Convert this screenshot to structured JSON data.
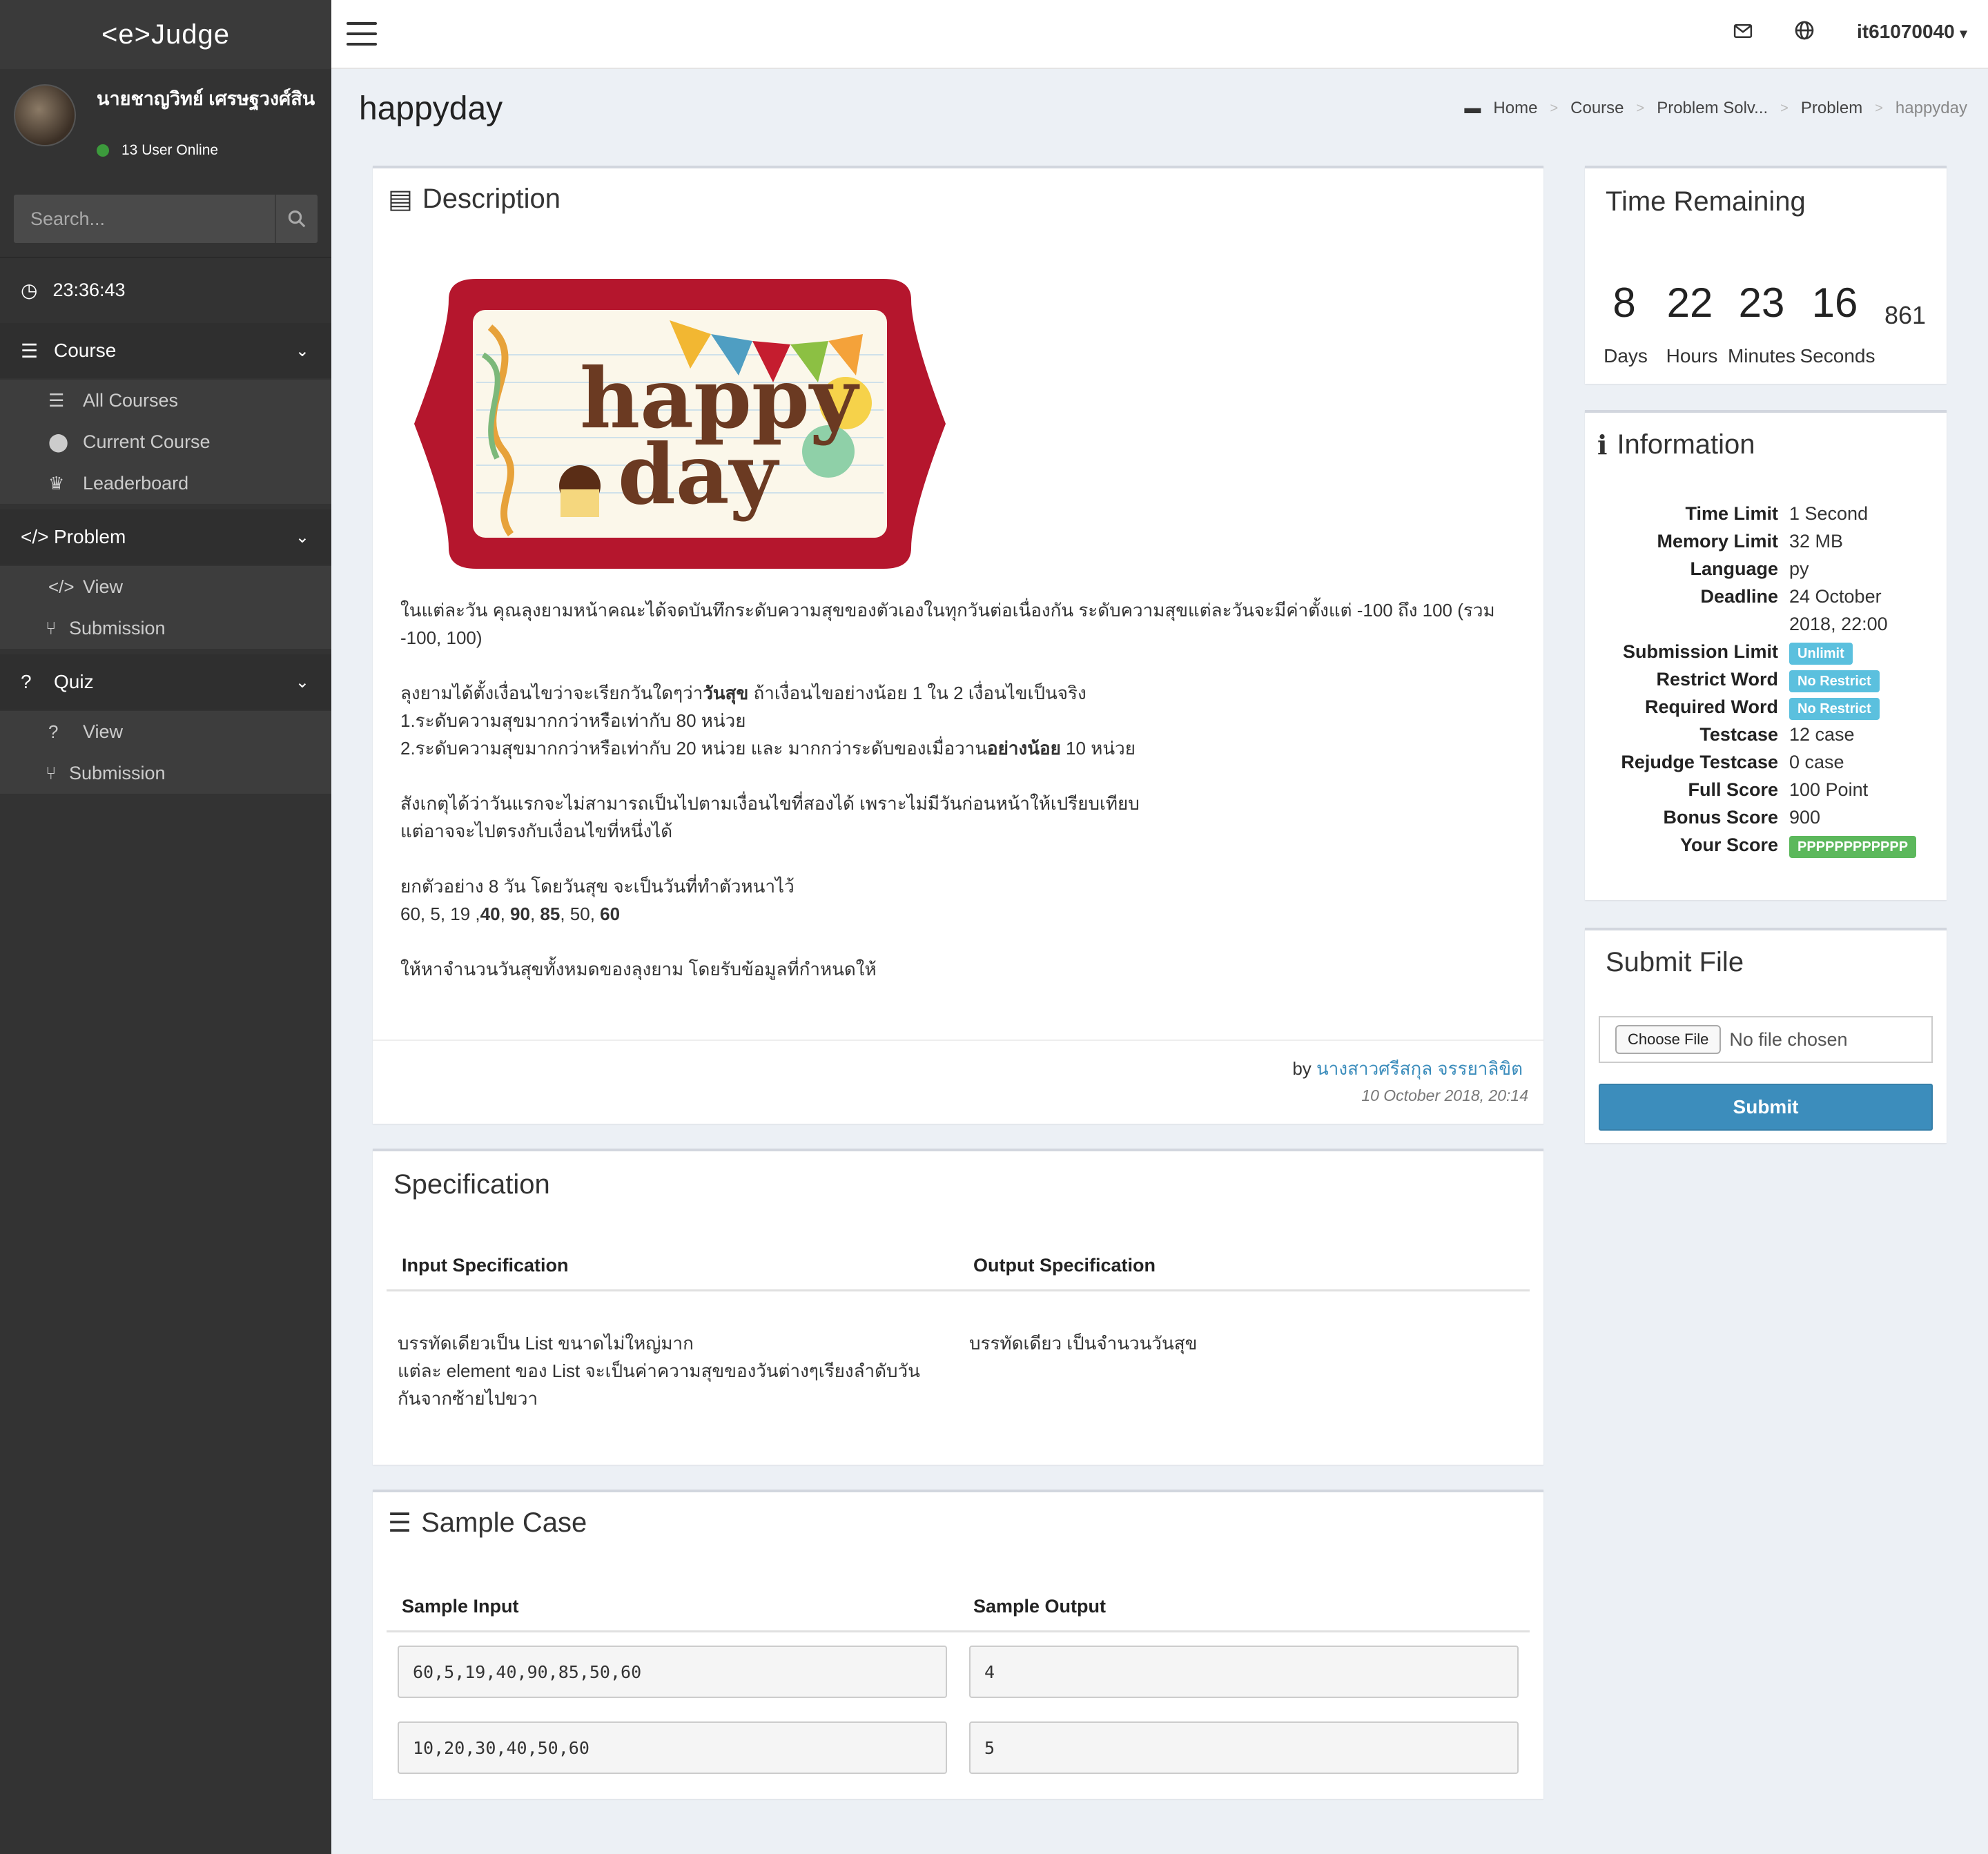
{
  "app": {
    "brand": "<e>Judge"
  },
  "user": {
    "name": "นายชาญวิทย์ เศรษฐวงศ์สิน",
    "online_text": "13 User Online",
    "dropdown": "it61070040"
  },
  "search": {
    "placeholder": "Search..."
  },
  "clock": "23:36:43",
  "nav": {
    "course": {
      "label": "Course",
      "items": [
        "All Courses",
        "Current Course",
        "Leaderboard"
      ]
    },
    "problem": {
      "label": "Problem",
      "items": [
        "View",
        "Submission"
      ]
    },
    "quiz": {
      "label": "Quiz",
      "items": [
        "View",
        "Submission"
      ]
    }
  },
  "page": {
    "title": "happyday"
  },
  "breadcrumb": [
    "Home",
    "Course",
    "Problem Solv...",
    "Problem",
    "happyday"
  ],
  "description": {
    "title": "Description",
    "image_text": "happy day",
    "p1": "ในแต่ละวัน คุณลุงยามหน้าคณะได้จดบันทึกระดับความสุขของตัวเองในทุกวันต่อเนื่องกัน ระดับความสุขแต่ละวันจะมีค่าตั้งแต่ -100 ถึง 100 (รวม -100, 100)",
    "p2a": "ลุงยามได้ตั้งเงื่อนไขว่าจะเรียกวันใดๆว่า",
    "p2b": "วันสุข",
    "p2c": " ถ้าเงื่อนไขอย่างน้อย 1 ใน 2 เงื่อนไขเป็นจริง",
    "p2d": "1.ระดับความสุขมากกว่าหรือเท่ากับ 80 หน่วย",
    "p2e": "2.ระดับความสุขมากกว่าหรือเท่ากับ 20 หน่วย และ มากกว่าระดับของเมื่อวาน",
    "p2f": "อย่างน้อย",
    "p2g": " 10 หน่วย",
    "p3a": "สังเกตุได้ว่าวันแรกจะไม่สามารถเป็นไปตามเงื่อนไขที่สองได้ เพราะไม่มีวันก่อนหน้าให้เปรียบเทียบ",
    "p3b": "แต่อาจจะไปตรงกับเงื่อนไขที่หนึ่งได้",
    "p4a": "ยกตัวอย่าง 8 วัน โดยวันสุข จะเป็นวันที่ทำตัวหนาไว้",
    "p4_plain1": "60, 5, 19 ,",
    "p4_b1": "40",
    "p4_sep1": ", ",
    "p4_b2": "90",
    "p4_sep2": ", ",
    "p4_b3": "85",
    "p4_sep3": ", 50, ",
    "p4_b4": "60",
    "p5": "ให้หาจำนวนวันสุขทั้งหมดของลุงยาม โดยรับข้อมูลที่กำหนดให้",
    "by_label": "by",
    "author": "นางสาวศรีสกุล จรรยาลิขิต",
    "date": "10 October 2018, 20:14"
  },
  "specification": {
    "title": "Specification",
    "input_header": "Input Specification",
    "output_header": "Output Specification",
    "input_l1": "บรรทัดเดียวเป็น List ขนาดไม่ใหญ่มาก",
    "input_l2": "แต่ละ element ของ List จะเป็นค่าความสุขของวันต่างๆเรียงลำดับวัน",
    "input_l3": "กันจากซ้ายไปขวา",
    "output": "บรรทัดเดียว เป็นจำนวนวันสุข"
  },
  "sample": {
    "title": "Sample Case",
    "input_header": "Sample Input",
    "output_header": "Sample Output",
    "cases": [
      {
        "input": "60,5,19,40,90,85,50,60",
        "output": "4"
      },
      {
        "input": "10,20,30,40,50,60",
        "output": "5"
      }
    ]
  },
  "timer": {
    "title": "Time Remaining",
    "days": "8",
    "hours": "22",
    "minutes": "23",
    "seconds": "16",
    "ms": "861",
    "days_label": "Days",
    "hours_label": "Hours",
    "minutes_label": "Minutes",
    "seconds_label": "Seconds"
  },
  "info": {
    "title": "Information",
    "rows": [
      {
        "k": "Time Limit",
        "v": "1 Second"
      },
      {
        "k": "Memory Limit",
        "v": "32 MB"
      },
      {
        "k": "Language",
        "v": "py"
      },
      {
        "k": "Deadline",
        "v": "24 October"
      },
      {
        "k": "",
        "v": "2018, 22:00"
      },
      {
        "k": "Submission Limit",
        "v": "Unlimit"
      },
      {
        "k": "Restrict Word",
        "v": "No Restrict"
      },
      {
        "k": "Required Word",
        "v": "No Restrict"
      },
      {
        "k": "Testcase",
        "v": "12 case"
      },
      {
        "k": "Rejudge Testcase",
        "v": "0 case"
      },
      {
        "k": "Full Score",
        "v": "100 Point"
      },
      {
        "k": "Bonus Score",
        "v": "900"
      },
      {
        "k": "Your Score",
        "v": "PPPPPPPPPPPP"
      }
    ]
  },
  "submit": {
    "title": "Submit File",
    "choose_label": "Choose File",
    "no_file": "No file chosen",
    "button": "Submit"
  },
  "colors": {
    "accent": "#3c8dbc",
    "badge_info": "#5bc0de",
    "badge_success": "#5cb85c",
    "sidebar": "#333333"
  }
}
